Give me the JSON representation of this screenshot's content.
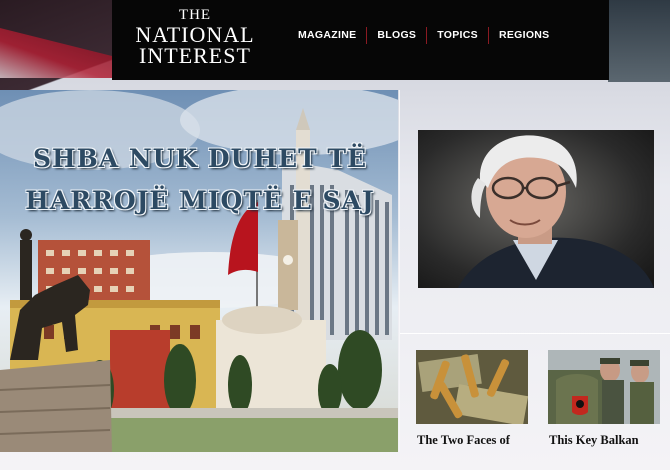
{
  "site": {
    "logo_the": "THE",
    "logo_name": "NATIONAL",
    "logo_interest": "INTEREST"
  },
  "nav": {
    "items": [
      {
        "label": "MAGAZINE"
      },
      {
        "label": "BLOGS"
      },
      {
        "label": "TOPICS"
      },
      {
        "label": "REGIONS"
      }
    ]
  },
  "hero": {
    "headline_line1": "SHBA NUK DUHET TË",
    "headline_line2": "HARROJË MIQTË E SAJ"
  },
  "cards": [
    {
      "title": "The Two Faces of",
      "icon": "bullets-money-image"
    },
    {
      "title": "This Key Balkan",
      "icon": "soldiers-image"
    }
  ],
  "colors": {
    "header_bg": "#060606",
    "nav_separator": "#8a1a22",
    "headline": "#2d4a63"
  }
}
